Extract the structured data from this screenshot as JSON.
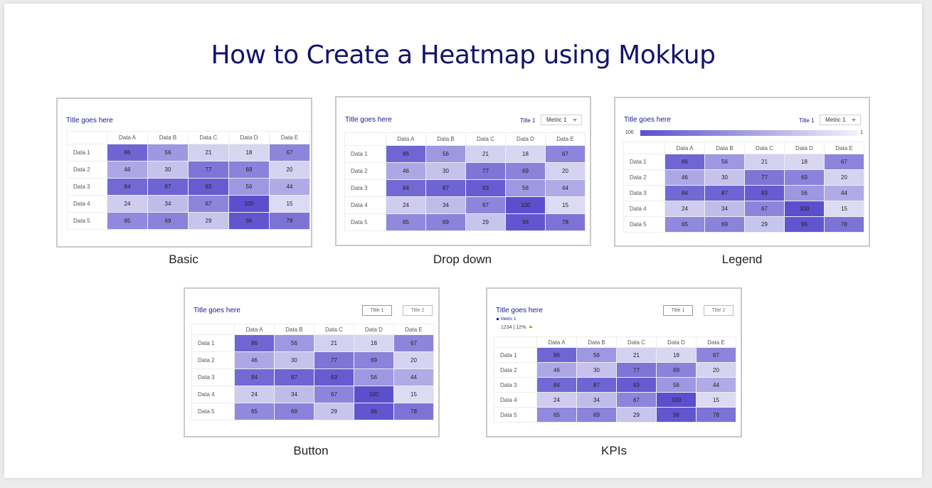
{
  "page_title": "How to Create a Heatmap using Mokkup",
  "colors": {
    "low": "#f2f2f9",
    "high": "#5b4fcd",
    "title": "#13136b"
  },
  "heatmap": {
    "title": "Title goes here",
    "columns": [
      "Data A",
      "Data B",
      "Data C",
      "Data D",
      "Data E"
    ],
    "rows": [
      "Data 1",
      "Data 2",
      "Data 3",
      "Data 4",
      "Data 5"
    ]
  },
  "controls": {
    "dropdown_label": "Title 1",
    "dropdown_value": "Metric 1",
    "button_1": "Title 1",
    "button_2": "Title 2",
    "legend_max": "100",
    "legend_min": "1",
    "kpi_metric": "Metric 1",
    "kpi_value": "1234 | 12%"
  },
  "captions": [
    "Basic",
    "Drop down",
    "Legend",
    "Button",
    "KPIs"
  ],
  "chart_data": {
    "type": "heatmap",
    "x": [
      "Data A",
      "Data B",
      "Data C",
      "Data D",
      "Data E"
    ],
    "y": [
      "Data 1",
      "Data 2",
      "Data 3",
      "Data 4",
      "Data 5"
    ],
    "values": [
      [
        86,
        56,
        21,
        18,
        67
      ],
      [
        46,
        30,
        77,
        69,
        20
      ],
      [
        84,
        87,
        93,
        56,
        44
      ],
      [
        24,
        34,
        67,
        100,
        15
      ],
      [
        65,
        69,
        29,
        96,
        78
      ]
    ],
    "title": "Title goes here",
    "color_range": [
      1,
      100
    ]
  }
}
